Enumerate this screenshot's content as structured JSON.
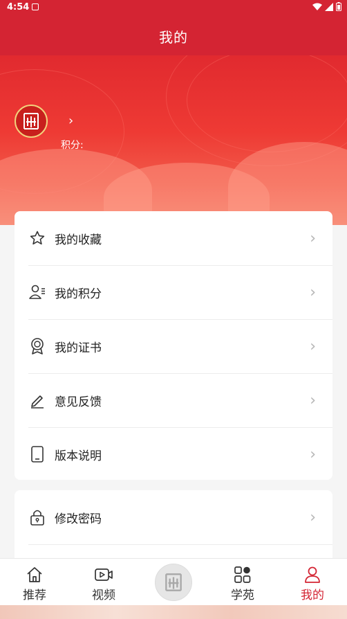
{
  "status": {
    "time": "4:54"
  },
  "header": {
    "title": "我的"
  },
  "profile": {
    "arrow": "›",
    "points_label": "积分:"
  },
  "menu": [
    {
      "label": "我的收藏",
      "icon": "star-icon"
    },
    {
      "label": "我的积分",
      "icon": "user-points-icon"
    },
    {
      "label": "我的证书",
      "icon": "certificate-icon"
    },
    {
      "label": "意见反馈",
      "icon": "pen-icon"
    },
    {
      "label": "版本说明",
      "icon": "phone-icon"
    }
  ],
  "menu2": [
    {
      "label": "修改密码",
      "icon": "lock-icon"
    }
  ],
  "nav": [
    {
      "label": "推荐",
      "icon": "home-icon"
    },
    {
      "label": "视频",
      "icon": "video-icon"
    },
    {
      "label": "学苑",
      "icon": "grid-icon"
    },
    {
      "label": "我的",
      "icon": "user-icon",
      "active": true
    }
  ],
  "colors": {
    "primary": "#d42433",
    "chevron": "#b5b5b5"
  }
}
